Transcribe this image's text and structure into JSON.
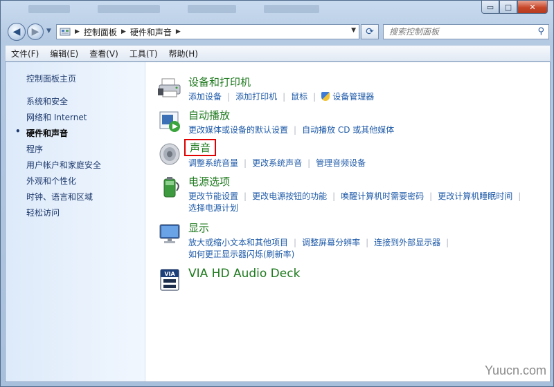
{
  "window": {
    "minimize": "▭",
    "maximize": "□",
    "close": "✕"
  },
  "nav": {
    "back": "◀",
    "forward": "▶",
    "breadcrumb": [
      "控制面板",
      "硬件和声音"
    ],
    "search_placeholder": "搜索控制面板"
  },
  "menu": [
    "文件(F)",
    "编辑(E)",
    "查看(V)",
    "工具(T)",
    "帮助(H)"
  ],
  "sidebar": {
    "home": "控制面板主页",
    "items": [
      "系统和安全",
      "网络和 Internet",
      "硬件和声音",
      "程序",
      "用户帐户和家庭安全",
      "外观和个性化",
      "时钟、语言和区域",
      "轻松访问"
    ],
    "active_index": 2
  },
  "categories": [
    {
      "title": "设备和打印机",
      "icon": "printer-icon",
      "lines": [
        [
          "添加设备",
          "添加打印机",
          "鼠标",
          "设备管理器"
        ]
      ]
    },
    {
      "title": "自动播放",
      "icon": "autoplay-icon",
      "lines": [
        [
          "更改媒体或设备的默认设置",
          "自动播放 CD 或其他媒体"
        ]
      ]
    },
    {
      "title": "声音",
      "icon": "speaker-icon",
      "highlighted": true,
      "lines": [
        [
          "调整系统音量",
          "更改系统声音",
          "管理音频设备"
        ]
      ]
    },
    {
      "title": "电源选项",
      "icon": "battery-icon",
      "lines": [
        [
          "更改节能设置",
          "更改电源按钮的功能",
          "唤醒计算机时需要密码",
          "更改计算机睡眠时间"
        ],
        [
          "选择电源计划"
        ]
      ]
    },
    {
      "title": "显示",
      "icon": "monitor-icon",
      "lines": [
        [
          "放大或缩小文本和其他项目",
          "调整屏幕分辨率",
          "连接到外部显示器"
        ],
        [
          "如何更正显示器闪烁(刷新率)"
        ]
      ]
    },
    {
      "title": "VIA HD Audio Deck",
      "icon": "via-audio-icon",
      "lines": []
    }
  ],
  "watermark": "Yuucn.com",
  "colors": {
    "link": "#1e5aa8",
    "category_title": "#1f7a1f",
    "highlight_box": "#e00000"
  }
}
